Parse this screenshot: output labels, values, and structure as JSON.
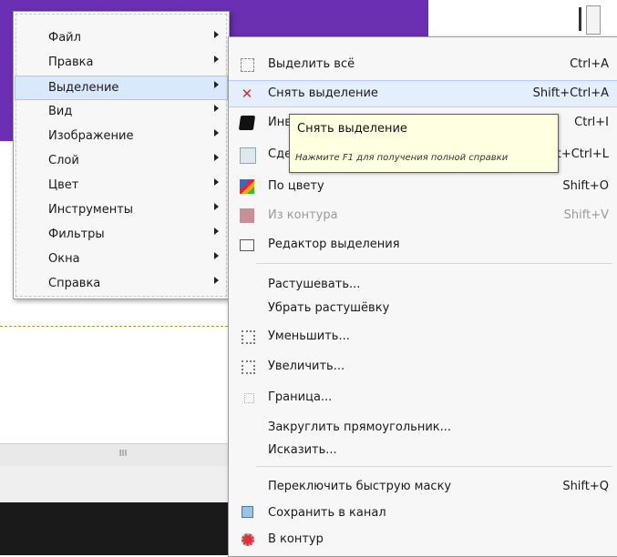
{
  "main_menu": {
    "items": [
      {
        "label": "Файл"
      },
      {
        "label": "Правка"
      },
      {
        "label": "Выделение"
      },
      {
        "label": "Вид"
      },
      {
        "label": "Изображение"
      },
      {
        "label": "Слой"
      },
      {
        "label": "Цвет"
      },
      {
        "label": "Инструменты"
      },
      {
        "label": "Фильтры"
      },
      {
        "label": "Окна"
      },
      {
        "label": "Справка"
      }
    ],
    "active_index": 2
  },
  "submenu": {
    "items": [
      {
        "label": "Выделить всё",
        "shortcut": "Ctrl+A",
        "icon": "select-all-icon"
      },
      {
        "label": "Снять выделение",
        "shortcut": "Shift+Ctrl+A",
        "icon": "remove-selection-icon"
      },
      {
        "label": "Инвертировать",
        "shortcut": "Ctrl+I",
        "icon": "invert-icon"
      },
      {
        "label": "Сделать плавающим",
        "shortcut": "Shift+Ctrl+L",
        "icon": "float-icon"
      },
      {
        "label": "По цвету",
        "shortcut": "Shift+O",
        "icon": "by-color-icon"
      },
      {
        "label": "Из контура",
        "shortcut": "Shift+V",
        "icon": "from-path-icon"
      },
      {
        "label": "Редактор выделения",
        "shortcut": "",
        "icon": "selection-editor-icon"
      },
      {
        "label": "Растушевать...",
        "shortcut": "",
        "icon": ""
      },
      {
        "label": "Убрать растушёвку",
        "shortcut": "",
        "icon": ""
      },
      {
        "label": "Уменьшить...",
        "shortcut": "",
        "icon": "shrink-icon"
      },
      {
        "label": "Увеличить...",
        "shortcut": "",
        "icon": "grow-icon"
      },
      {
        "label": "Граница...",
        "shortcut": "",
        "icon": "border-icon"
      },
      {
        "label": "Закруглить прямоугольник...",
        "shortcut": "",
        "icon": ""
      },
      {
        "label": "Исказить...",
        "shortcut": "",
        "icon": ""
      },
      {
        "label": "Переключить быструю маску",
        "shortcut": "Shift+Q",
        "icon": ""
      },
      {
        "label": "Сохранить в канал",
        "shortcut": "",
        "icon": "save-to-channel-icon"
      },
      {
        "label": "В контур",
        "shortcut": "",
        "icon": "to-path-icon"
      }
    ],
    "highlight_index": 1,
    "disabled_index": 5
  },
  "tooltip": {
    "title": "Снять выделение",
    "hint": "Нажмите F1 для получения полной справки"
  },
  "scrollbar": {
    "thumb_label": "III"
  },
  "colors": {
    "canvas_purple": "#6a2fb2",
    "menu_bg": "#f7f7f7",
    "tooltip_bg": "#ffffe1",
    "highlight": "#d9e8fb",
    "remove_icon": "#d42a2a"
  }
}
